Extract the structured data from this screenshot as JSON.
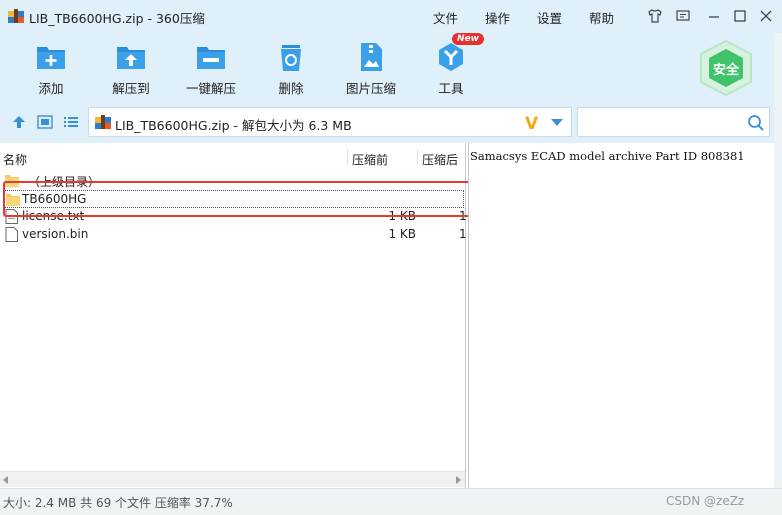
{
  "window": {
    "title": "LIB_TB6600HG.zip - 360压缩",
    "menu": [
      "文件",
      "操作",
      "设置",
      "帮助"
    ]
  },
  "toolbar": {
    "buttons": [
      {
        "label": "添加",
        "icon": "add-icon"
      },
      {
        "label": "解压到",
        "icon": "extract-to-icon"
      },
      {
        "label": "一键解压",
        "icon": "one-click-extract-icon"
      },
      {
        "label": "删除",
        "icon": "recycle-delete-icon"
      },
      {
        "label": "图片压缩",
        "icon": "image-compress-icon"
      },
      {
        "label": "工具",
        "icon": "tools-icon"
      }
    ],
    "new_badge": "New",
    "safe_label": "安全",
    "accent": "#2b8fd8",
    "safe_color": "#3fc46b"
  },
  "address": {
    "path_text": "LIB_TB6600HG.zip - 解包大小为 6.3 MB",
    "search_placeholder": ""
  },
  "file_list": {
    "columns": [
      "名称",
      "压缩前",
      "压缩后"
    ],
    "rows": [
      {
        "name": "（上级目录）",
        "type": "folder",
        "size": "",
        "csize": ""
      },
      {
        "name": "TB6600HG",
        "type": "folder",
        "size": "",
        "csize": ""
      },
      {
        "name": "license.txt",
        "type": "file",
        "size": "1 KB",
        "csize": "1"
      },
      {
        "name": "version.bin",
        "type": "file",
        "size": "1 KB",
        "csize": "1"
      }
    ],
    "highlight_color": "#e53935"
  },
  "comment": {
    "text": "Samacsys ECAD model archive Part ID 808381"
  },
  "status": {
    "text": "大小: 2.4 MB 共 69 个文件 压缩率 37.7%",
    "watermark": "CSDN @zeZz"
  }
}
